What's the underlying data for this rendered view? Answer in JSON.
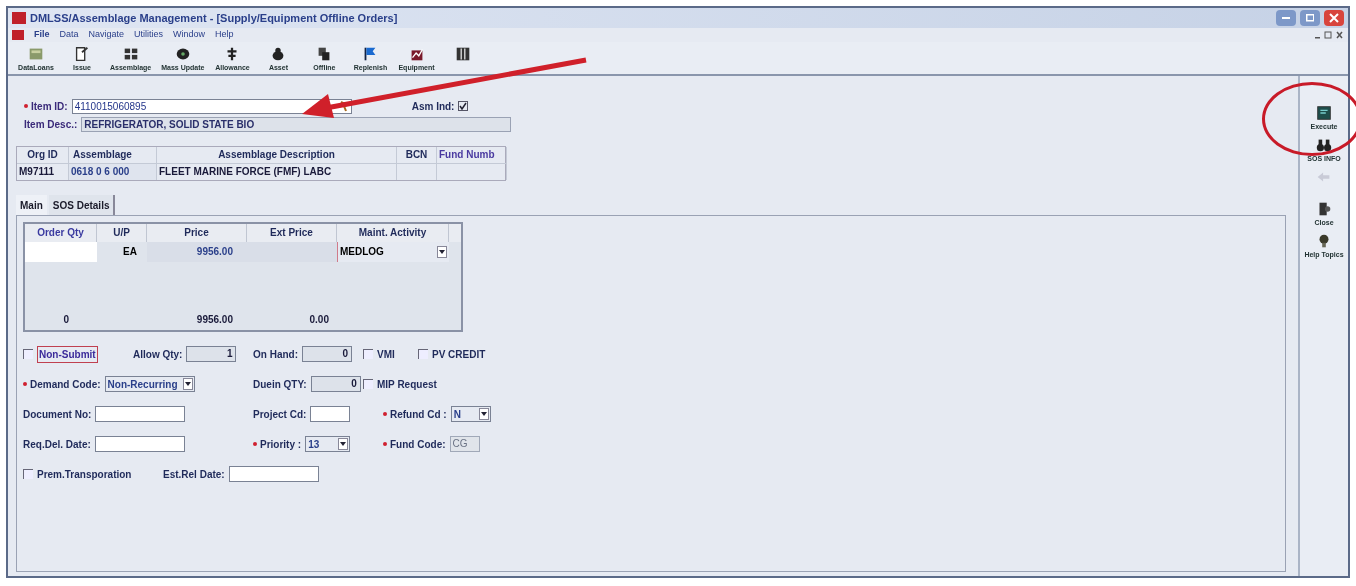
{
  "window": {
    "title": "DMLSS/Assemblage Management - [Supply/Equipment Offline Orders]"
  },
  "menu": [
    "File",
    "Data",
    "Navigate",
    "Utilities",
    "Window",
    "Help"
  ],
  "toolbar": [
    {
      "label": "DataLoans",
      "kind": "box"
    },
    {
      "label": "Issue",
      "kind": "doc"
    },
    {
      "label": "Assemblage",
      "kind": "grid"
    },
    {
      "label": "Mass Update",
      "kind": "disc"
    },
    {
      "label": "Allowance",
      "kind": "tree"
    },
    {
      "label": "Asset",
      "kind": "bag"
    },
    {
      "label": "Offline",
      "kind": "pages"
    },
    {
      "label": "Replenish",
      "kind": "flag"
    },
    {
      "label": "Equipment",
      "kind": "chart"
    },
    {
      "kind": "columns"
    }
  ],
  "item": {
    "id_label": "Item ID:",
    "id_value": "4110015060895",
    "required": true,
    "asm_label": "Asm Ind:",
    "asm_checked": true,
    "desc_label": "Item Desc.:",
    "desc_value": "REFRIGERATOR, SOLID STATE BIO"
  },
  "assemblage_table": {
    "columns": [
      "Org ID",
      "Assemblage",
      "Assemblage Description",
      "BCN",
      "Fund Numb"
    ],
    "row": {
      "org_id": "M97111",
      "assemblage": "0618 0 6 000",
      "description": "FLEET MARINE FORCE (FMF) LABC"
    }
  },
  "tabs": [
    {
      "label": "Main",
      "selected": true
    },
    {
      "label": "SOS Details",
      "selected": false
    }
  ],
  "order_grid": {
    "columns": [
      "Order Qty",
      "U/P",
      "Price",
      "Ext Price",
      "Maint. Activity"
    ],
    "row": {
      "unit": "EA",
      "price": "9956.00",
      "maint_activity": "MEDLOG"
    },
    "totals": [
      "0",
      "9956.00",
      "0.00"
    ]
  },
  "form_rows": [
    [
      {
        "kind": "check",
        "label": "Non-Submit",
        "checked": false
      },
      {
        "kind": "field",
        "label": "Allow Qty:",
        "value": "1",
        "disabled": true
      },
      {
        "kind": "field",
        "label": "On Hand:",
        "value": "0",
        "disabled": true
      },
      {
        "kind": "check",
        "label": "VMI",
        "checked": false
      },
      {
        "kind": "check",
        "label": "PV CREDIT",
        "checked": false
      }
    ],
    [
      {
        "kind": "select",
        "label": "Demand Code:",
        "value": "Non-Recurring",
        "required": true
      },
      {
        "kind": "field",
        "label": "Duein QTY:",
        "value": "0",
        "disabled": true
      },
      {
        "kind": "check",
        "label": "MIP Request",
        "checked": false
      }
    ],
    [
      {
        "kind": "field",
        "label": "Document No:",
        "disabled": false
      },
      {
        "kind": "field",
        "label": "Project Cd:",
        "disabled": false
      },
      {
        "kind": "select",
        "label": "Refund Cd :",
        "value": "N",
        "required": true
      }
    ],
    [
      {
        "kind": "field",
        "label": "Req.Del. Date:",
        "disabled": false
      },
      {
        "kind": "select",
        "label": "Priority :",
        "value": "13",
        "required": true
      },
      {
        "kind": "field",
        "label": "Fund Code:",
        "value": "CG",
        "disabled": true,
        "required": true
      }
    ],
    [
      {
        "kind": "check",
        "label": "Prem.Transporation",
        "checked": false
      },
      {
        "kind": "field",
        "label": "Est.Rel Date:",
        "disabled": false
      }
    ]
  ],
  "side_toolbar": [
    {
      "label": "Execute",
      "kind": "screen",
      "disabled": false
    },
    {
      "label": "SOS INFO",
      "kind": "binoculars",
      "disabled": false
    },
    {
      "kind": "back",
      "disabled": true
    },
    {
      "label": "Close",
      "kind": "door",
      "disabled": false
    },
    {
      "label": "Help Topics",
      "kind": "bulb",
      "disabled": false
    }
  ]
}
